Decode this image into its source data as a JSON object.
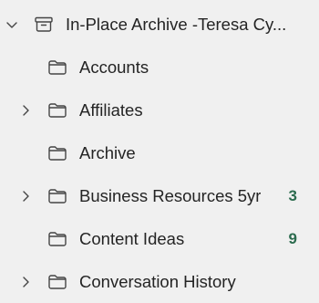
{
  "root": {
    "label": "In-Place Archive -Teresa Cy...",
    "expanded": true,
    "icon": "archive-box-icon"
  },
  "folders": [
    {
      "label": "Accounts",
      "has_children": false,
      "count": ""
    },
    {
      "label": "Affiliates",
      "has_children": true,
      "count": ""
    },
    {
      "label": "Archive",
      "has_children": false,
      "count": ""
    },
    {
      "label": "Business Resources 5yr",
      "has_children": true,
      "count": "3"
    },
    {
      "label": "Content Ideas",
      "has_children": false,
      "count": "9"
    },
    {
      "label": "Conversation History",
      "has_children": true,
      "count": ""
    }
  ],
  "colors": {
    "background": "#f0f0f0",
    "text": "#242424",
    "count": "#2b6b4e",
    "icon": "#444444"
  }
}
